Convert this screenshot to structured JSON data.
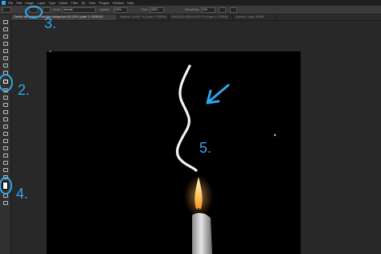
{
  "menu": {
    "items": [
      "File",
      "Edit",
      "Image",
      "Layer",
      "Type",
      "Select",
      "Filter",
      "3D",
      "View",
      "Plugins",
      "Window",
      "Help"
    ]
  },
  "options_bar": {
    "mode_label": "Mode:",
    "mode_value": "Normal",
    "opacity_label": "Opacity:",
    "opacity_value": "100%",
    "flow_label": "Flow:",
    "flow_value": "100%",
    "smoothing_label": "Smoothing:",
    "smoothing_value": "10%"
  },
  "tabs": [
    {
      "label": "Candle with geese on wooden background @ 101% (Layer 1, RGB/16) *"
    },
    {
      "label": "Untitled-1 @ 66.7% (Layer 1, RGB/8)"
    },
    {
      "label": "ISMA2020-638.tif @ 83.7% (Layer 1, RGB/8)"
    },
    {
      "label": "Canvas 1 copy, RGB/8"
    }
  ],
  "annotations": {
    "step3": "3.",
    "step2": "2.",
    "step4": "4.",
    "step5": "5.",
    "dot": "."
  },
  "colors": {
    "annotation": "#2fa6ec",
    "canvas": "#000000",
    "candle": "#d9d9d9",
    "flame": "#ffd27a"
  },
  "icons": [
    "move-icon",
    "marquee-icon",
    "lasso-icon",
    "quick-select-icon",
    "crop-icon",
    "frame-icon",
    "eyedropper-icon",
    "healing-icon",
    "brush-icon",
    "stamp-icon",
    "history-brush-icon",
    "eraser-icon",
    "gradient-icon",
    "blur-icon",
    "dodge-icon",
    "pen-icon",
    "type-icon",
    "path-select-icon",
    "shape-icon",
    "hand-icon",
    "zoom-icon",
    "more-icon",
    "color-swatch-icon",
    "quick-mask-icon",
    "screen-mode-icon"
  ]
}
